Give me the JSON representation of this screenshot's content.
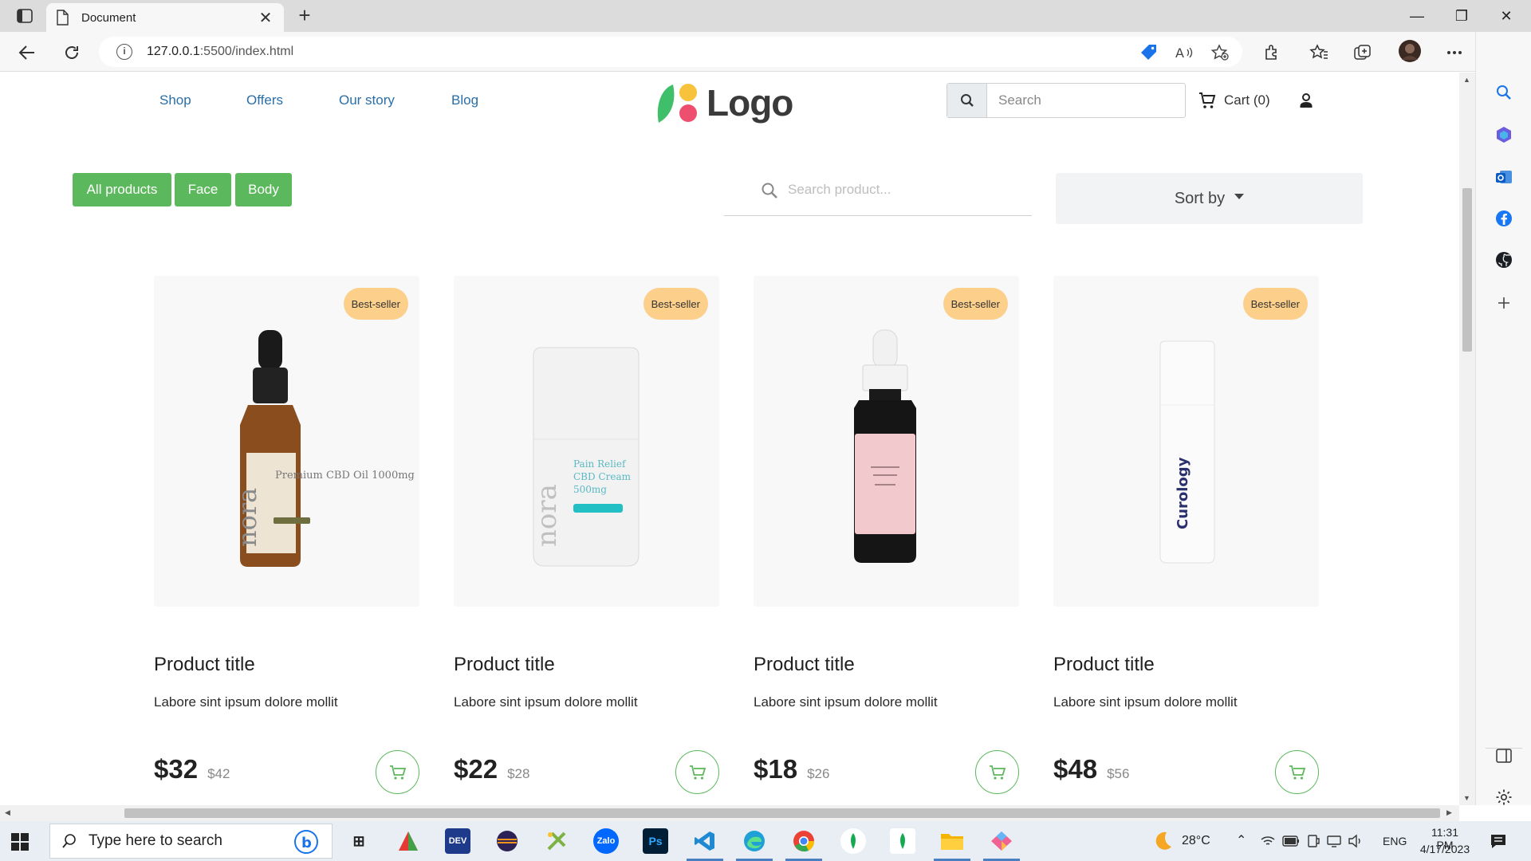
{
  "browser": {
    "tab_title": "Document",
    "url_host": "127.0.0.1",
    "url_rest": ":5500/index.html"
  },
  "site": {
    "nav": [
      "Shop",
      "Offers",
      "Our story",
      "Blog"
    ],
    "logo_text": "Logo",
    "search_placeholder": "Search",
    "cart_label": "Cart (0)"
  },
  "filters": {
    "chips": [
      "All products",
      "Face",
      "Body"
    ],
    "product_search_placeholder": "Search product...",
    "sort_label": "Sort by"
  },
  "products": [
    {
      "badge": "Best-seller",
      "title": "Product title",
      "desc": "Labore sint ipsum dolore mollit",
      "price": "$32",
      "old_price": "$42",
      "image": "amber-dropper-bottle",
      "bottle_text": "Premium CBD Oil 1000mg"
    },
    {
      "badge": "Best-seller",
      "title": "Product title",
      "desc": "Labore sint ipsum dolore mollit",
      "price": "$22",
      "old_price": "$28",
      "image": "white-cream-jar",
      "bottle_text": "Pain Relief CBD Cream 500mg"
    },
    {
      "badge": "Best-seller",
      "title": "Product title",
      "desc": "Labore sint ipsum dolore mollit",
      "price": "$18",
      "old_price": "$26",
      "image": "black-dropper-bottle-pink-label",
      "bottle_text": ""
    },
    {
      "badge": "Best-seller",
      "title": "Product title",
      "desc": "Labore sint ipsum dolore mollit",
      "price": "$48",
      "old_price": "$56",
      "image": "white-pump-bottle",
      "bottle_text": "Curology"
    }
  ],
  "taskbar": {
    "search_placeholder": "Type here to search",
    "temperature": "28°C",
    "language": "ENG",
    "time": "11:31 PM",
    "date": "4/17/2023"
  },
  "colors": {
    "accent_green": "#5cb85c",
    "badge": "#fcd08a",
    "nav_link": "#2a6ea7"
  }
}
